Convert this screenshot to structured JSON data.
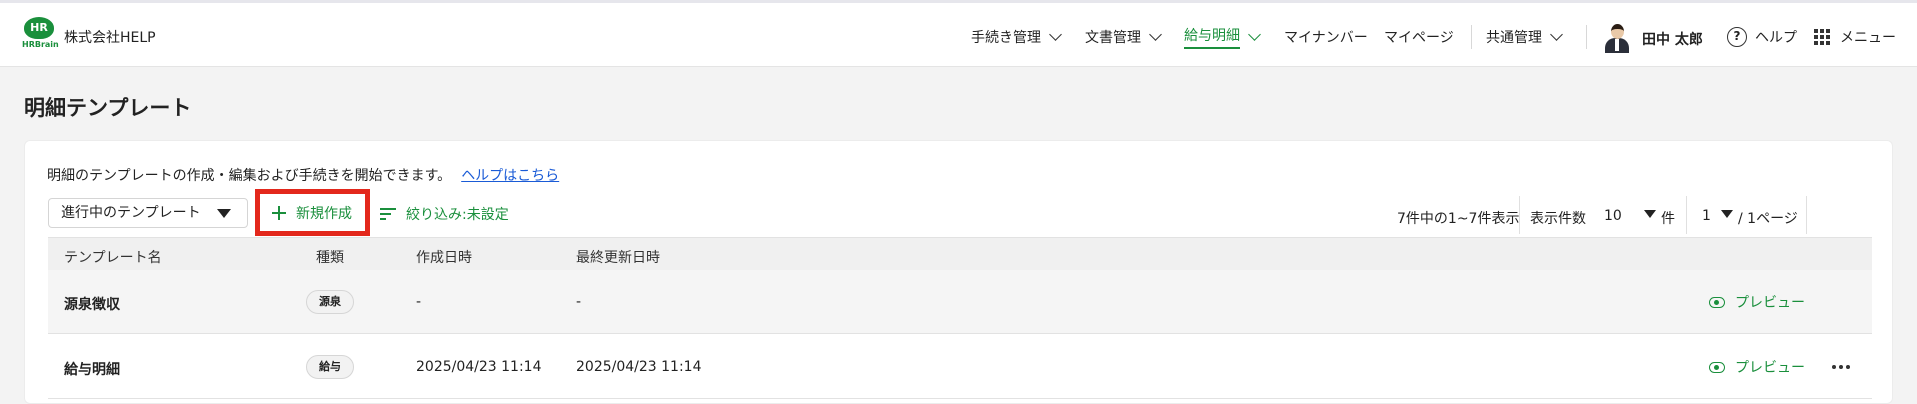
{
  "header": {
    "logo_badge": "HR",
    "logo_word": "HRBrain",
    "company": "株式会社HELP",
    "nav": [
      {
        "label": "手続き管理",
        "has_dropdown": true,
        "active": false
      },
      {
        "label": "文書管理",
        "has_dropdown": true,
        "active": false
      },
      {
        "label": "給与明細",
        "has_dropdown": true,
        "active": true
      },
      {
        "label": "マイナンバー",
        "has_dropdown": false,
        "active": false
      },
      {
        "label": "マイページ",
        "has_dropdown": false,
        "active": false
      },
      {
        "label": "共通管理",
        "has_dropdown": true,
        "active": false
      }
    ],
    "user_name": "田中 太郎",
    "help_label": "ヘルプ",
    "menu_label": "メニュー"
  },
  "page": {
    "title": "明細テンプレート",
    "description": "明細のテンプレートの作成・編集および手続きを開始できます。",
    "help_link": "ヘルプはこちら"
  },
  "toolbar": {
    "status_select": "進行中のテンプレート",
    "new_button": "新規作成",
    "filter_label": "絞り込み:未設定",
    "count_text": "7件中の1~7件表示",
    "per_page_label": "表示件数",
    "per_page_value": "10",
    "per_page_unit": "件",
    "page_value": "1",
    "page_total": "/ 1ページ"
  },
  "table": {
    "headers": [
      "テンプレート名",
      "種類",
      "作成日時",
      "最終更新日時"
    ],
    "preview_label": "プレビュー",
    "rows": [
      {
        "name": "源泉徴収",
        "type": "源泉",
        "created": "-",
        "updated": "-",
        "has_more_menu": false
      },
      {
        "name": "給与明細",
        "type": "給与",
        "created": "2025/04/23 11:14",
        "updated": "2025/04/23 11:14",
        "has_more_menu": true
      }
    ]
  },
  "colors": {
    "brand_green": "#1a8f3c",
    "highlight_red": "#e3281c",
    "link_blue": "#1a5bd6"
  },
  "icons": [
    "chevron-down-icon",
    "question-circle-icon",
    "grid-menu-icon",
    "plus-icon",
    "filter-lines-icon",
    "eye-icon",
    "more-dots-icon",
    "triangle-down-icon"
  ]
}
